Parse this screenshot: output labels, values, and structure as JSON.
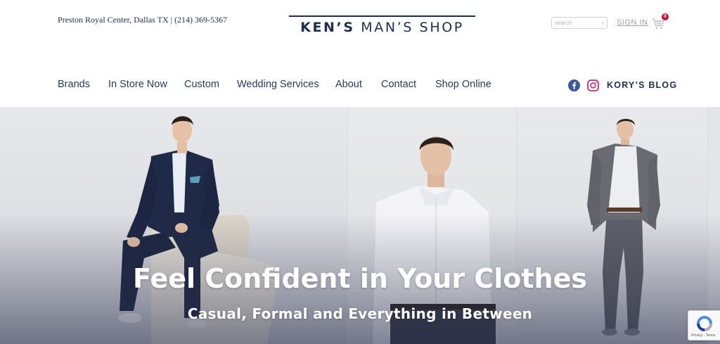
{
  "header": {
    "address": "Preston Royal Center, Dallas TX | (214) 369-5367",
    "logo": {
      "part1": "KEN’S",
      "part2": " MAN’S SHOP"
    },
    "search": {
      "placeholder": "search"
    },
    "signin_label": "SIGN IN",
    "cart_count": "0",
    "accent_color": "#1f2e4c",
    "badge_color": "#c8102e"
  },
  "nav": {
    "items": [
      {
        "label": "Brands"
      },
      {
        "label": "In Store Now"
      },
      {
        "label": "Custom"
      },
      {
        "label": "Wedding Services"
      },
      {
        "label": "About"
      },
      {
        "label": "Contact"
      },
      {
        "label": "Shop Online"
      }
    ],
    "social": [
      {
        "icon": "facebook-icon",
        "color": "#3b5998"
      },
      {
        "icon": "instagram-icon",
        "color": "#c13584"
      }
    ],
    "blog_label": "KORY’S BLOG"
  },
  "hero": {
    "title": "Feel Confident in Your Clothes",
    "subtitle": "Casual, Formal and Everything in Between"
  },
  "recaptcha": {
    "terms": "Privacy - Terms"
  }
}
